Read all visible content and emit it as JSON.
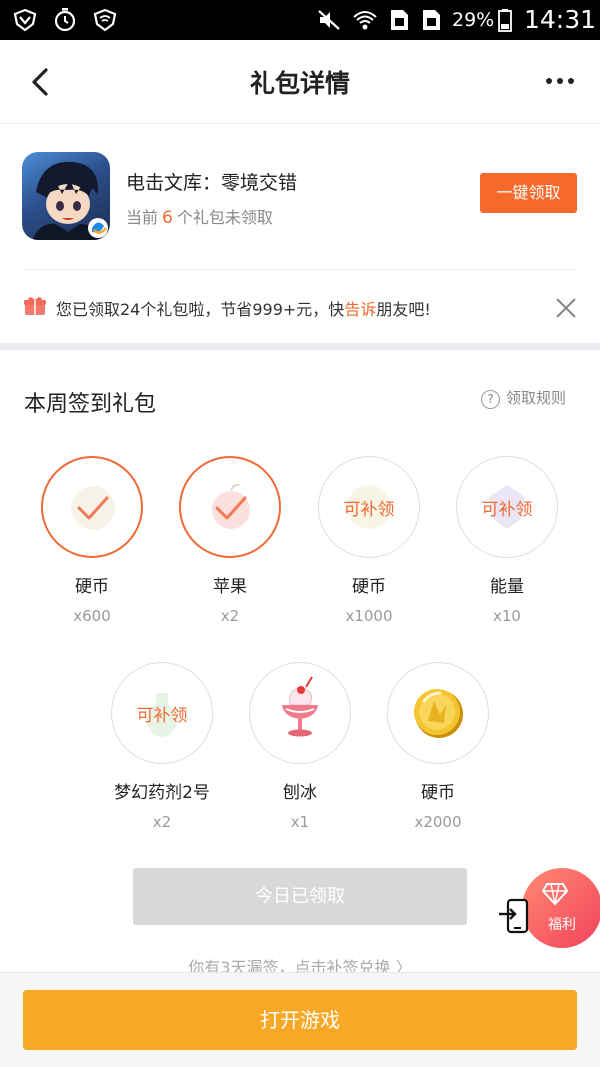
{
  "status_bar": {
    "icons": [
      "vpn-shield-icon",
      "alarm-clock-icon",
      "wifi-shield-icon",
      "mute-icon",
      "wifi-icon",
      "sim1-icon",
      "sim2-icon",
      "battery-icon"
    ],
    "battery": "29%",
    "time": "14:31"
  },
  "header": {
    "title": "礼包详情",
    "back_icon": "chevron-left-icon",
    "more_icon": "more-dots-icon"
  },
  "game": {
    "name": "电击文库：零境交错",
    "sub_prefix": "当前",
    "unclaimed_count": "6",
    "sub_suffix": "个礼包未领取",
    "claim_all": "一键领取"
  },
  "notice": {
    "prefix": "您已领取24个礼包啦，节省999+元，快",
    "highlight": "告诉",
    "suffix": "朋友吧!",
    "colors": {
      "highlight": "#f26a2b"
    }
  },
  "weekly": {
    "title": "本周签到礼包",
    "rules": "领取规则",
    "rewards": [
      {
        "name": "硬币",
        "qty": "x600",
        "status": "claimed"
      },
      {
        "name": "苹果",
        "qty": "x2",
        "status": "claimed"
      },
      {
        "name": "硬币",
        "qty": "x1000",
        "status": "refill",
        "refill_label": "可补领"
      },
      {
        "name": "能量",
        "qty": "x10",
        "status": "refill",
        "refill_label": "可补领"
      },
      {
        "name": "梦幻药剂2号",
        "qty": "x2",
        "status": "refill",
        "refill_label": "可补领"
      },
      {
        "name": "刨冰",
        "qty": "x1",
        "status": "available"
      },
      {
        "name": "硬币",
        "qty": "x2000",
        "status": "available"
      }
    ],
    "today_button": "今日已领取",
    "miss_text": "你有3天漏签，点击补签兑换 〉"
  },
  "float": {
    "welfare_label": "福利"
  },
  "bottom": {
    "open_game": "打开游戏"
  },
  "colors": {
    "accent": "#f5692b",
    "open_game": "#f9a825",
    "ring": "#f06a37"
  }
}
